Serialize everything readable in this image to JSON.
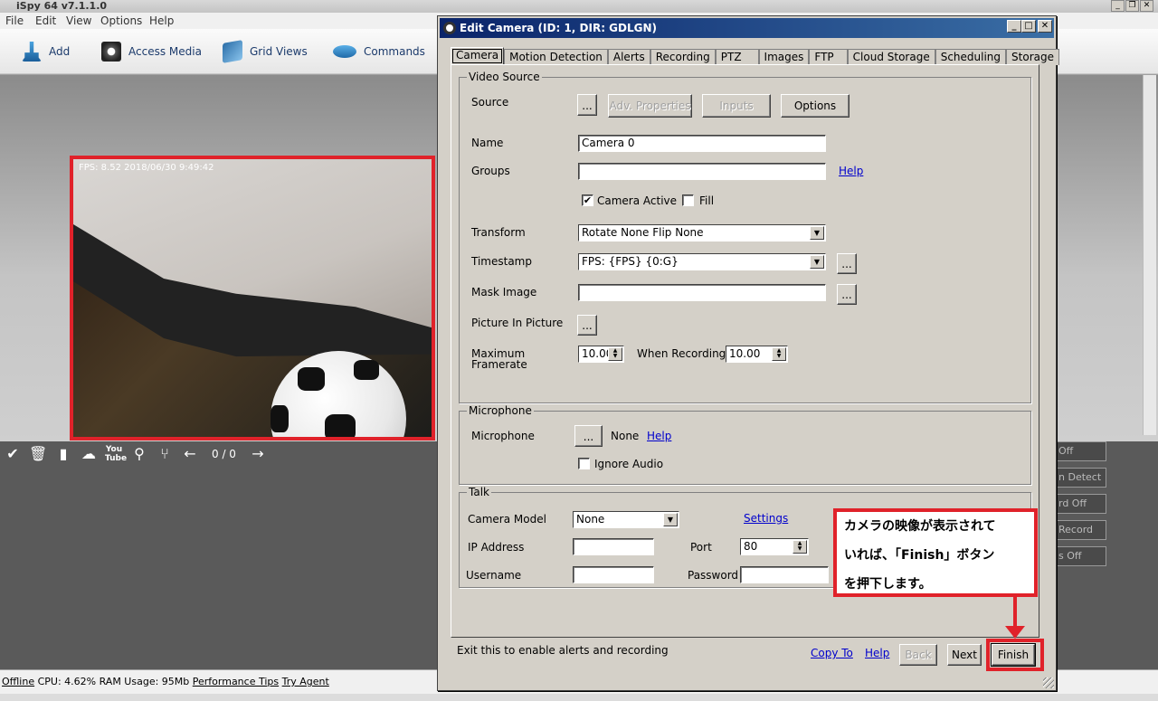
{
  "app": {
    "title": "iSpy 64 v7.1.1.0",
    "menu": [
      "File",
      "Edit",
      "View",
      "Options",
      "Help"
    ],
    "toolbar": [
      "Add",
      "Access Media",
      "Grid Views",
      "Commands"
    ]
  },
  "camera_view": {
    "overlay": "FPS: 8.52 2018/06/30 9:49:42",
    "counter": "0 / 0"
  },
  "right_buttons": [
    "Off",
    "n Detect",
    "rd Off",
    "Record",
    "s Off"
  ],
  "statusbar": {
    "offline": "Offline",
    "stats": "CPU: 4.62% RAM Usage: 95Mb",
    "performance_tips": "Performance Tips",
    "try_agent": "Try Agent"
  },
  "dialog": {
    "title": "Edit Camera (ID: 1, DIR: GDLGN)",
    "tabs": [
      "Camera",
      "Motion Detection",
      "Alerts",
      "Recording",
      "PTZ",
      "Images",
      "FTP",
      "Cloud Storage",
      "Scheduling",
      "Storage"
    ],
    "active_tab": "Camera",
    "video_source": {
      "group_title": "Video Source",
      "source_label": "Source",
      "browse": "...",
      "adv_properties": "Adv. Properties",
      "inputs": "Inputs",
      "options": "Options",
      "name_label": "Name",
      "name_value": "Camera 0",
      "groups_label": "Groups",
      "groups_value": "",
      "help": "Help",
      "camera_active": "Camera Active",
      "camera_active_checked": true,
      "fill": "Fill",
      "fill_checked": false,
      "transform_label": "Transform",
      "transform_value": "Rotate None Flip None",
      "timestamp_label": "Timestamp",
      "timestamp_value": "FPS: {FPS} {0:G}",
      "mask_label": "Mask Image",
      "mask_value": "",
      "pip_label": "Picture In Picture",
      "max_framerate_label_1": "Maximum",
      "max_framerate_label_2": "Framerate",
      "max_framerate_value": "10.00",
      "when_recording_label": "When Recording",
      "when_recording_value": "10.00"
    },
    "microphone": {
      "group_title": "Microphone",
      "label": "Microphone",
      "browse": "...",
      "value": "None",
      "help": "Help",
      "ignore_audio": "Ignore Audio",
      "ignore_audio_checked": false
    },
    "talk": {
      "group_title": "Talk",
      "camera_model_label": "Camera Model",
      "camera_model_value": "None",
      "settings": "Settings",
      "ip_label": "IP Address",
      "ip_value": "",
      "port_label": "Port",
      "port_value": "80",
      "username_label": "Username",
      "username_value": "",
      "password_label": "Password",
      "password_value": ""
    },
    "footer": {
      "hint": "Exit this to enable alerts and recording",
      "copy_to": "Copy To",
      "help": "Help",
      "back": "Back",
      "next": "Next",
      "finish": "Finish"
    }
  },
  "annotation": {
    "text": "カメラの映像が表示されて\nいれば、「Finish」ボタン\nを押下します。",
    "color": "#e0222a"
  }
}
